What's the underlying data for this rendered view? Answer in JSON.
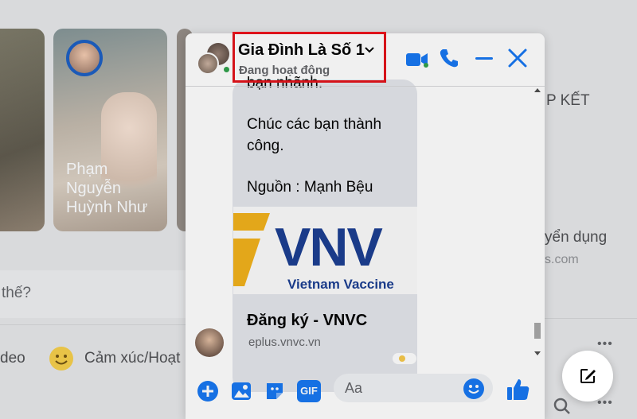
{
  "stories": [
    {
      "name": ""
    },
    {
      "name": "Phạm Nguyễn Huỳnh Như",
      "lines": [
        "Phạm",
        "Nguyễn",
        "Huỳnh Như"
      ]
    }
  ],
  "feed": {
    "post_prompt_partial": "thế?",
    "video_label_partial": "deo",
    "feeling_label": "Cảm xúc/Hoạt",
    "right_heading_partial": "P KẾT",
    "right_job_partial": "yển dụng",
    "right_domain_partial": "s.com",
    "more_dots": "•••"
  },
  "chat": {
    "title": "Gia Đình Là Số 1",
    "status": "Đang hoạt động",
    "message_partial_top": "bạn nhãnh.",
    "message_lines": [
      "Chúc các bạn thành",
      "công."
    ],
    "source": "Nguồn : Mạnh Bệu",
    "image_brand": "VNV",
    "image_caption": "Vietnam Vaccine",
    "link_title": "Đăng ký - VNVC",
    "link_url": "eplus.vnvc.vn",
    "input_placeholder": "Aa",
    "colors": {
      "accent": "#0a7cff",
      "online": "#31a24c",
      "highlight": "#e3141b",
      "brand": "#1c3f92"
    }
  },
  "icons": {
    "header": [
      "video-call-icon",
      "phone-icon",
      "minimize-icon",
      "close-icon"
    ],
    "composer": [
      "plus-icon",
      "image-icon",
      "sticker-icon",
      "gif-icon",
      "emoji-icon",
      "like-icon"
    ],
    "gif_label": "GIF"
  }
}
